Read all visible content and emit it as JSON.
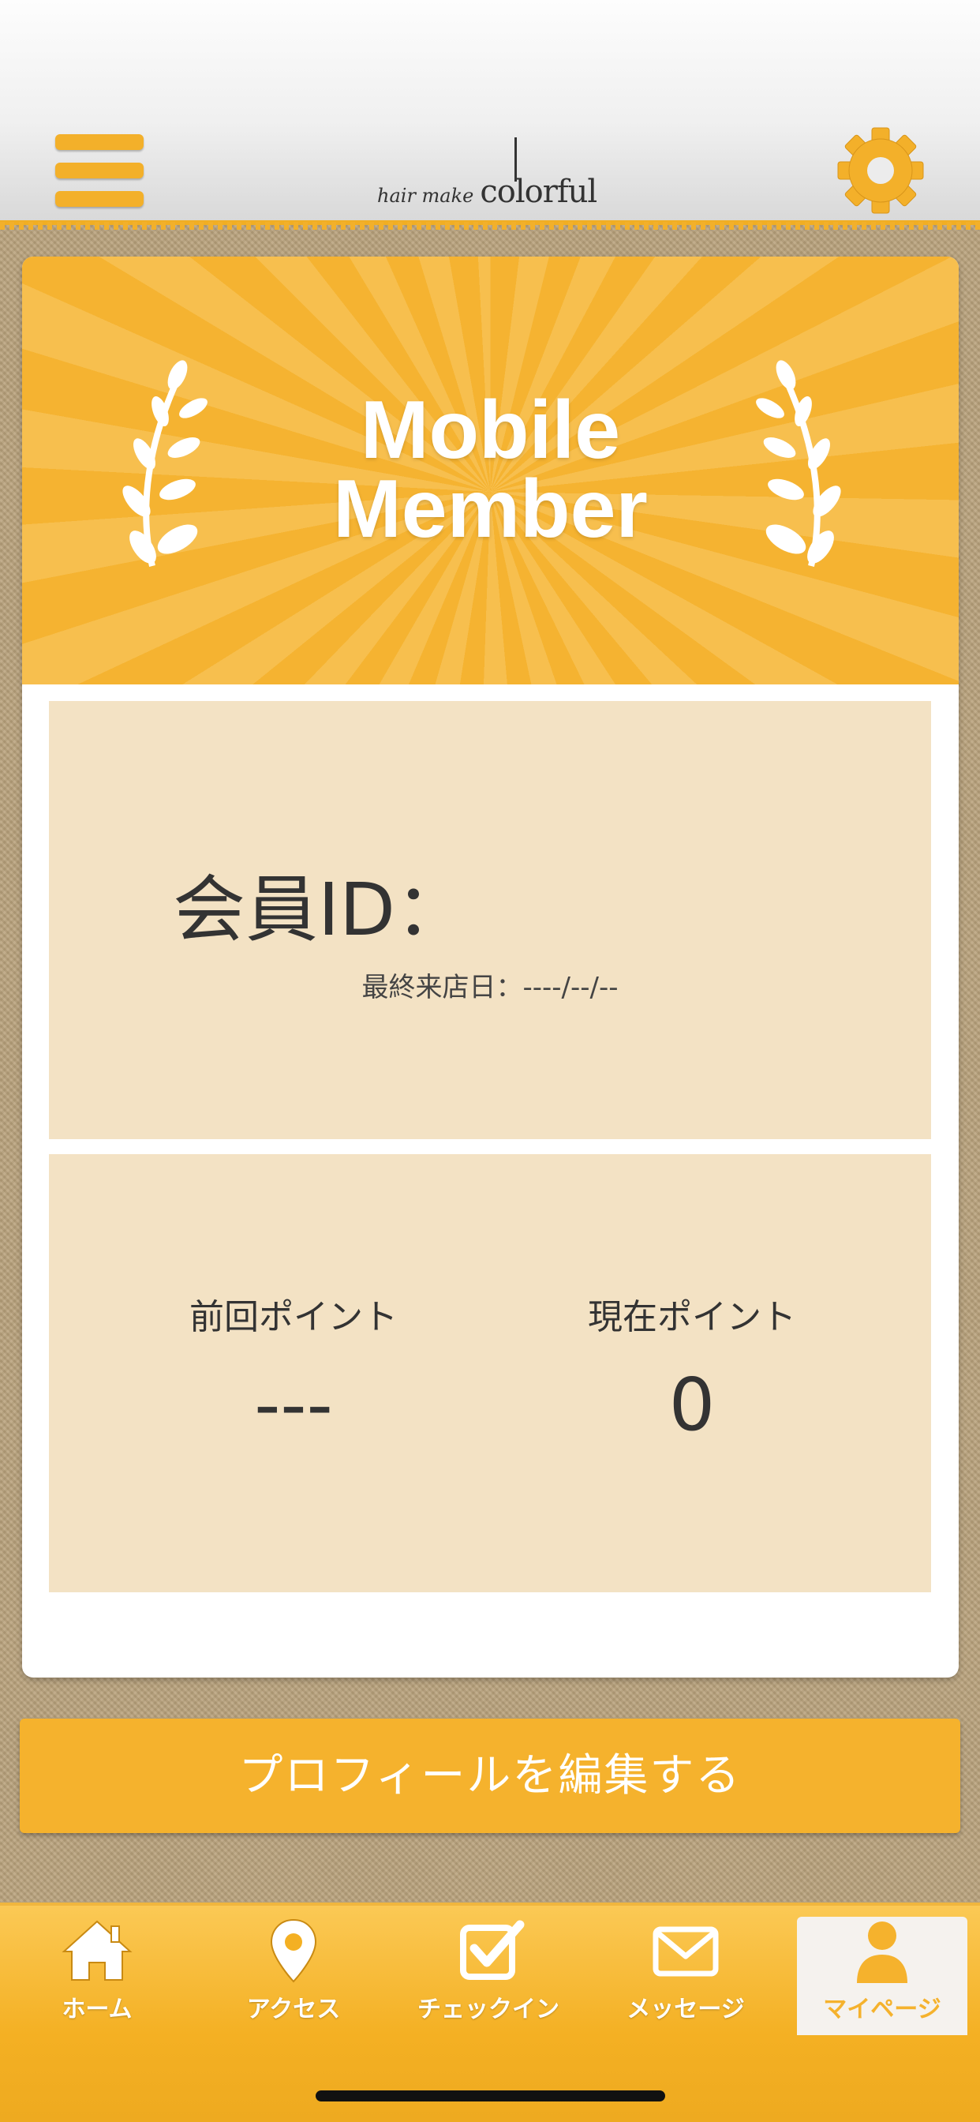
{
  "header": {
    "logo_small": "hair make",
    "logo_big": "colorful"
  },
  "banner": {
    "title_line1": "Mobile",
    "title_line2": "Member"
  },
  "member": {
    "id_label": "会員ID：",
    "last_visit": "最終来店日：----/--/--"
  },
  "points": {
    "previous_label": "前回ポイント",
    "previous_value": "---",
    "current_label": "現在ポイント",
    "current_value": "0"
  },
  "edit_profile_label": "プロフィールを編集する",
  "tabs": [
    {
      "label": "ホーム",
      "icon": "home-icon"
    },
    {
      "label": "アクセス",
      "icon": "map-pin-icon"
    },
    {
      "label": "チェックイン",
      "icon": "checkbox-icon"
    },
    {
      "label": "メッセージ",
      "icon": "envelope-icon"
    },
    {
      "label": "マイページ",
      "icon": "person-icon",
      "active": true
    }
  ],
  "colors": {
    "accent": "#f5b22d",
    "panel": "#f3e2c4",
    "tab_active_bg": "#f5f2ee"
  }
}
